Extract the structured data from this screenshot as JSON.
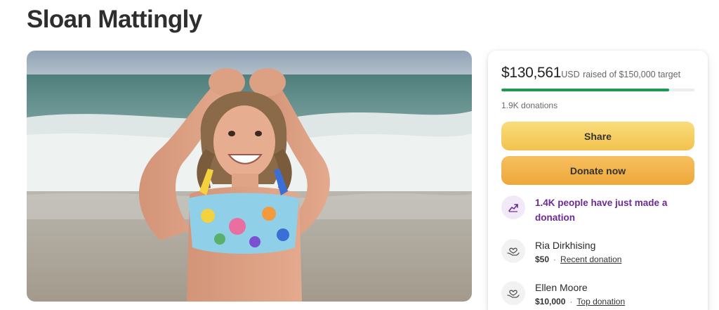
{
  "page": {
    "title": "Sloan Mattingly"
  },
  "fundraiser": {
    "amount_raised": "$130,561",
    "currency": "USD",
    "raised_text": "raised of $150,000 target",
    "progress_fraction": 0.87,
    "donation_count": "1.9K donations",
    "share_label": "Share",
    "donate_label": "Donate now",
    "trend_text": "1.4K people have just made a donation",
    "colors": {
      "progress": "#1d9a52",
      "trend_text": "#6b2b94",
      "share_button": "#f5cf61",
      "donate_button": "#f0b149"
    }
  },
  "donations": [
    {
      "name": "Ria Dirkhising",
      "amount": "$50",
      "tag": "Recent donation",
      "icon": "heart-hands-icon"
    },
    {
      "name": "Ellen Moore",
      "amount": "$10,000",
      "tag": "Top donation",
      "icon": "heart-hands-icon"
    }
  ],
  "icons": {
    "trend": "trending-up-icon",
    "donor": "heart-hands-icon"
  }
}
